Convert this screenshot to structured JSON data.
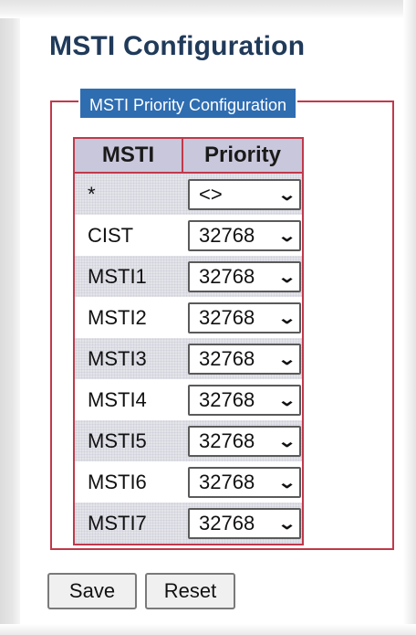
{
  "page": {
    "title": "MSTI Configuration"
  },
  "section": {
    "legend": "MSTI Priority Configuration"
  },
  "table": {
    "headers": {
      "msti": "MSTI",
      "priority": "Priority"
    },
    "rows": [
      {
        "label": "*",
        "priority": "<>"
      },
      {
        "label": "CIST",
        "priority": "32768"
      },
      {
        "label": "MSTI1",
        "priority": "32768"
      },
      {
        "label": "MSTI2",
        "priority": "32768"
      },
      {
        "label": "MSTI3",
        "priority": "32768"
      },
      {
        "label": "MSTI4",
        "priority": "32768"
      },
      {
        "label": "MSTI5",
        "priority": "32768"
      },
      {
        "label": "MSTI6",
        "priority": "32768"
      },
      {
        "label": "MSTI7",
        "priority": "32768"
      }
    ]
  },
  "buttons": {
    "save": "Save",
    "reset": "Reset"
  },
  "icons": {
    "dropdown": "chevron-down-icon"
  },
  "colors": {
    "title": "#203a5a",
    "legend_bg": "#2f6db1",
    "border": "#c0394b",
    "header_bg": "#c9c7db"
  }
}
